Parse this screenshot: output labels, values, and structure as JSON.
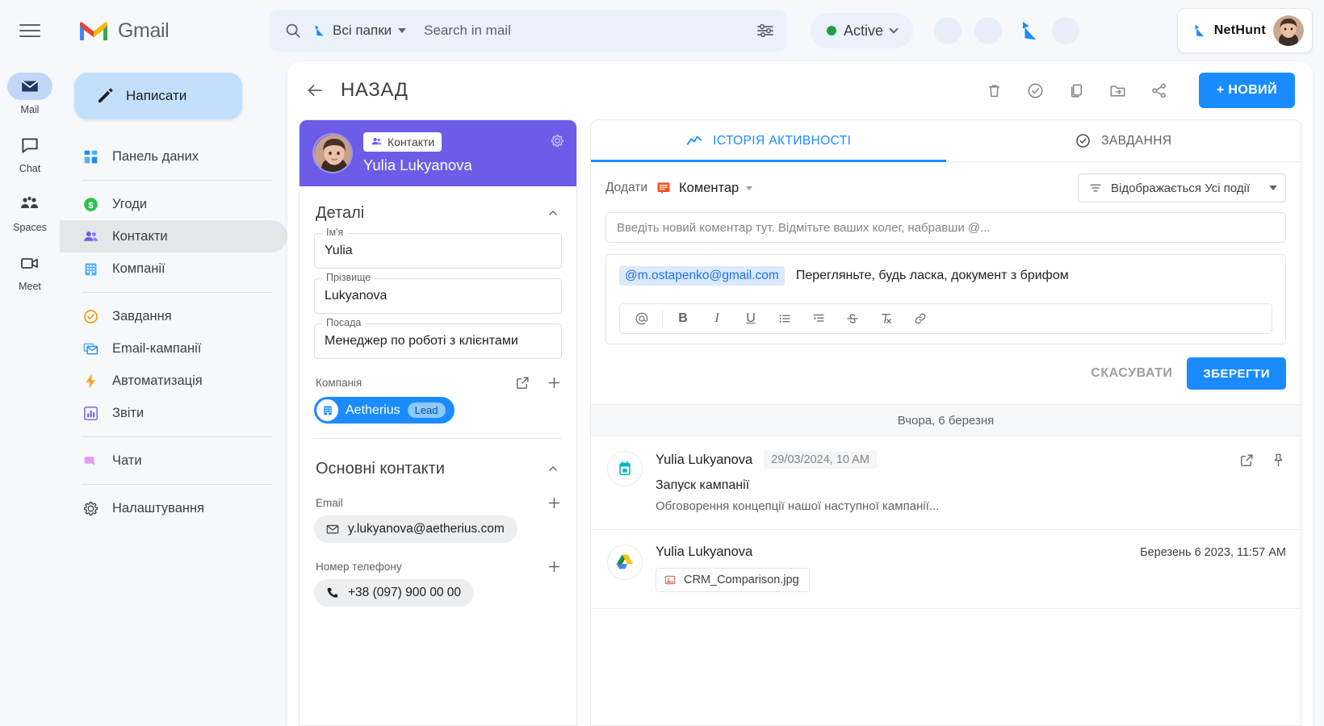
{
  "topbar": {
    "menu_icon": "hamburger-icon",
    "brand": "Gmail",
    "search": {
      "search_icon": "search-icon",
      "nethunt_icon": "nethunt-logo-icon",
      "folder_label": "Всі папки",
      "placeholder": "Search in mail",
      "options_icon": "search-options-icon"
    },
    "status": {
      "label": "Active",
      "dot_color": "#1e9f4b"
    },
    "account": {
      "brand_name": "NetHunt",
      "avatar": "user-avatar"
    }
  },
  "rail": {
    "items": [
      {
        "label": "Mail",
        "icon": "mail-icon",
        "active": true
      },
      {
        "label": "Chat",
        "icon": "chat-icon",
        "active": false
      },
      {
        "label": "Spaces",
        "icon": "spaces-icon",
        "active": false
      },
      {
        "label": "Meet",
        "icon": "meet-icon",
        "active": false
      }
    ]
  },
  "sidebar": {
    "compose_label": "Написати",
    "items": [
      {
        "label": "Панель даних",
        "icon": "dashboard-icon"
      },
      {
        "label": "Угоди",
        "icon": "deals-icon"
      },
      {
        "label": "Контакти",
        "icon": "contacts-icon"
      },
      {
        "label": "Компанії",
        "icon": "companies-icon"
      },
      {
        "label": "Завдання",
        "icon": "tasks-icon"
      },
      {
        "label": "Email-кампанії",
        "icon": "email-campaigns-icon"
      },
      {
        "label": "Автоматизація",
        "icon": "automation-icon"
      },
      {
        "label": "Звіти",
        "icon": "reports-icon"
      },
      {
        "label": "Чати",
        "icon": "chats-icon"
      },
      {
        "label": "Налаштування",
        "icon": "settings-icon"
      }
    ]
  },
  "toolbar": {
    "back_label": "НАЗАД",
    "actions": [
      "delete-icon",
      "complete-icon",
      "duplicate-icon",
      "move-to-folder-icon",
      "share-icon"
    ],
    "new_button": "+ НОВИЙ"
  },
  "contact_card": {
    "type_badge": "Контакти",
    "name": "Yulia Lukyanova",
    "gear_icon": "gear-icon",
    "details_section": {
      "title": "Деталі",
      "fields": [
        {
          "label": "Ім'я",
          "value": "Yulia"
        },
        {
          "label": "Прізвище",
          "value": "Lukyanova"
        },
        {
          "label": "Посада",
          "value": "Менеджер по роботі з клієнтами"
        }
      ],
      "company_label": "Компанія",
      "company_chip": {
        "name": "Aetherius",
        "tag": "Lead"
      }
    },
    "contacts_section": {
      "title": "Основні контакти",
      "email_label": "Email",
      "email_value": "y.lukyanova@aetherius.com",
      "phone_label": "Номер телефону",
      "phone_value": "+38 (097) 900 00 00"
    }
  },
  "right_panel": {
    "tabs": [
      {
        "label": "ІСТОРІЯ АКТИВНОСТІ",
        "icon": "activity-icon",
        "active": true
      },
      {
        "label": "ЗАВДАННЯ",
        "icon": "task-check-icon",
        "active": false
      }
    ],
    "composer": {
      "add_label": "Додати",
      "type_label": "Коментар",
      "type_icon": "comment-icon",
      "filter_icon": "filter-icon",
      "filter_label": "Відображається Усі події",
      "input_placeholder": "Введіть новий коментар тут. Відмітьте ваших колег, набравши @...",
      "mention": "@m.ostapenko@gmail.com",
      "draft_text": "Перегляньте, будь ласка, документ з брифом",
      "format_buttons": [
        "mention-icon",
        "bold-icon",
        "italic-icon",
        "underline-icon",
        "bullet-list-icon",
        "indent-icon",
        "strikethrough-icon",
        "clear-format-icon",
        "link-icon"
      ],
      "cancel_label": "СКАСУВАТИ",
      "save_label": "ЗБЕРЕГТИ"
    },
    "date_separator": "Вчора, 6 березня",
    "feed": [
      {
        "icon": "calendar-icon",
        "author": "Yulia Lukyanova",
        "time": "29/03/2024, 10 AM",
        "title": "Запуск кампанії",
        "description": "Обговорення концепції нашої наступної кампанії...",
        "actions": [
          "open-external-icon",
          "pin-icon"
        ]
      },
      {
        "icon": "google-drive-icon",
        "author": "Yulia Lukyanova",
        "time": "Березень 6 2023, 11:57 AM",
        "attachment": "CRM_Comparison.jpg"
      }
    ]
  }
}
